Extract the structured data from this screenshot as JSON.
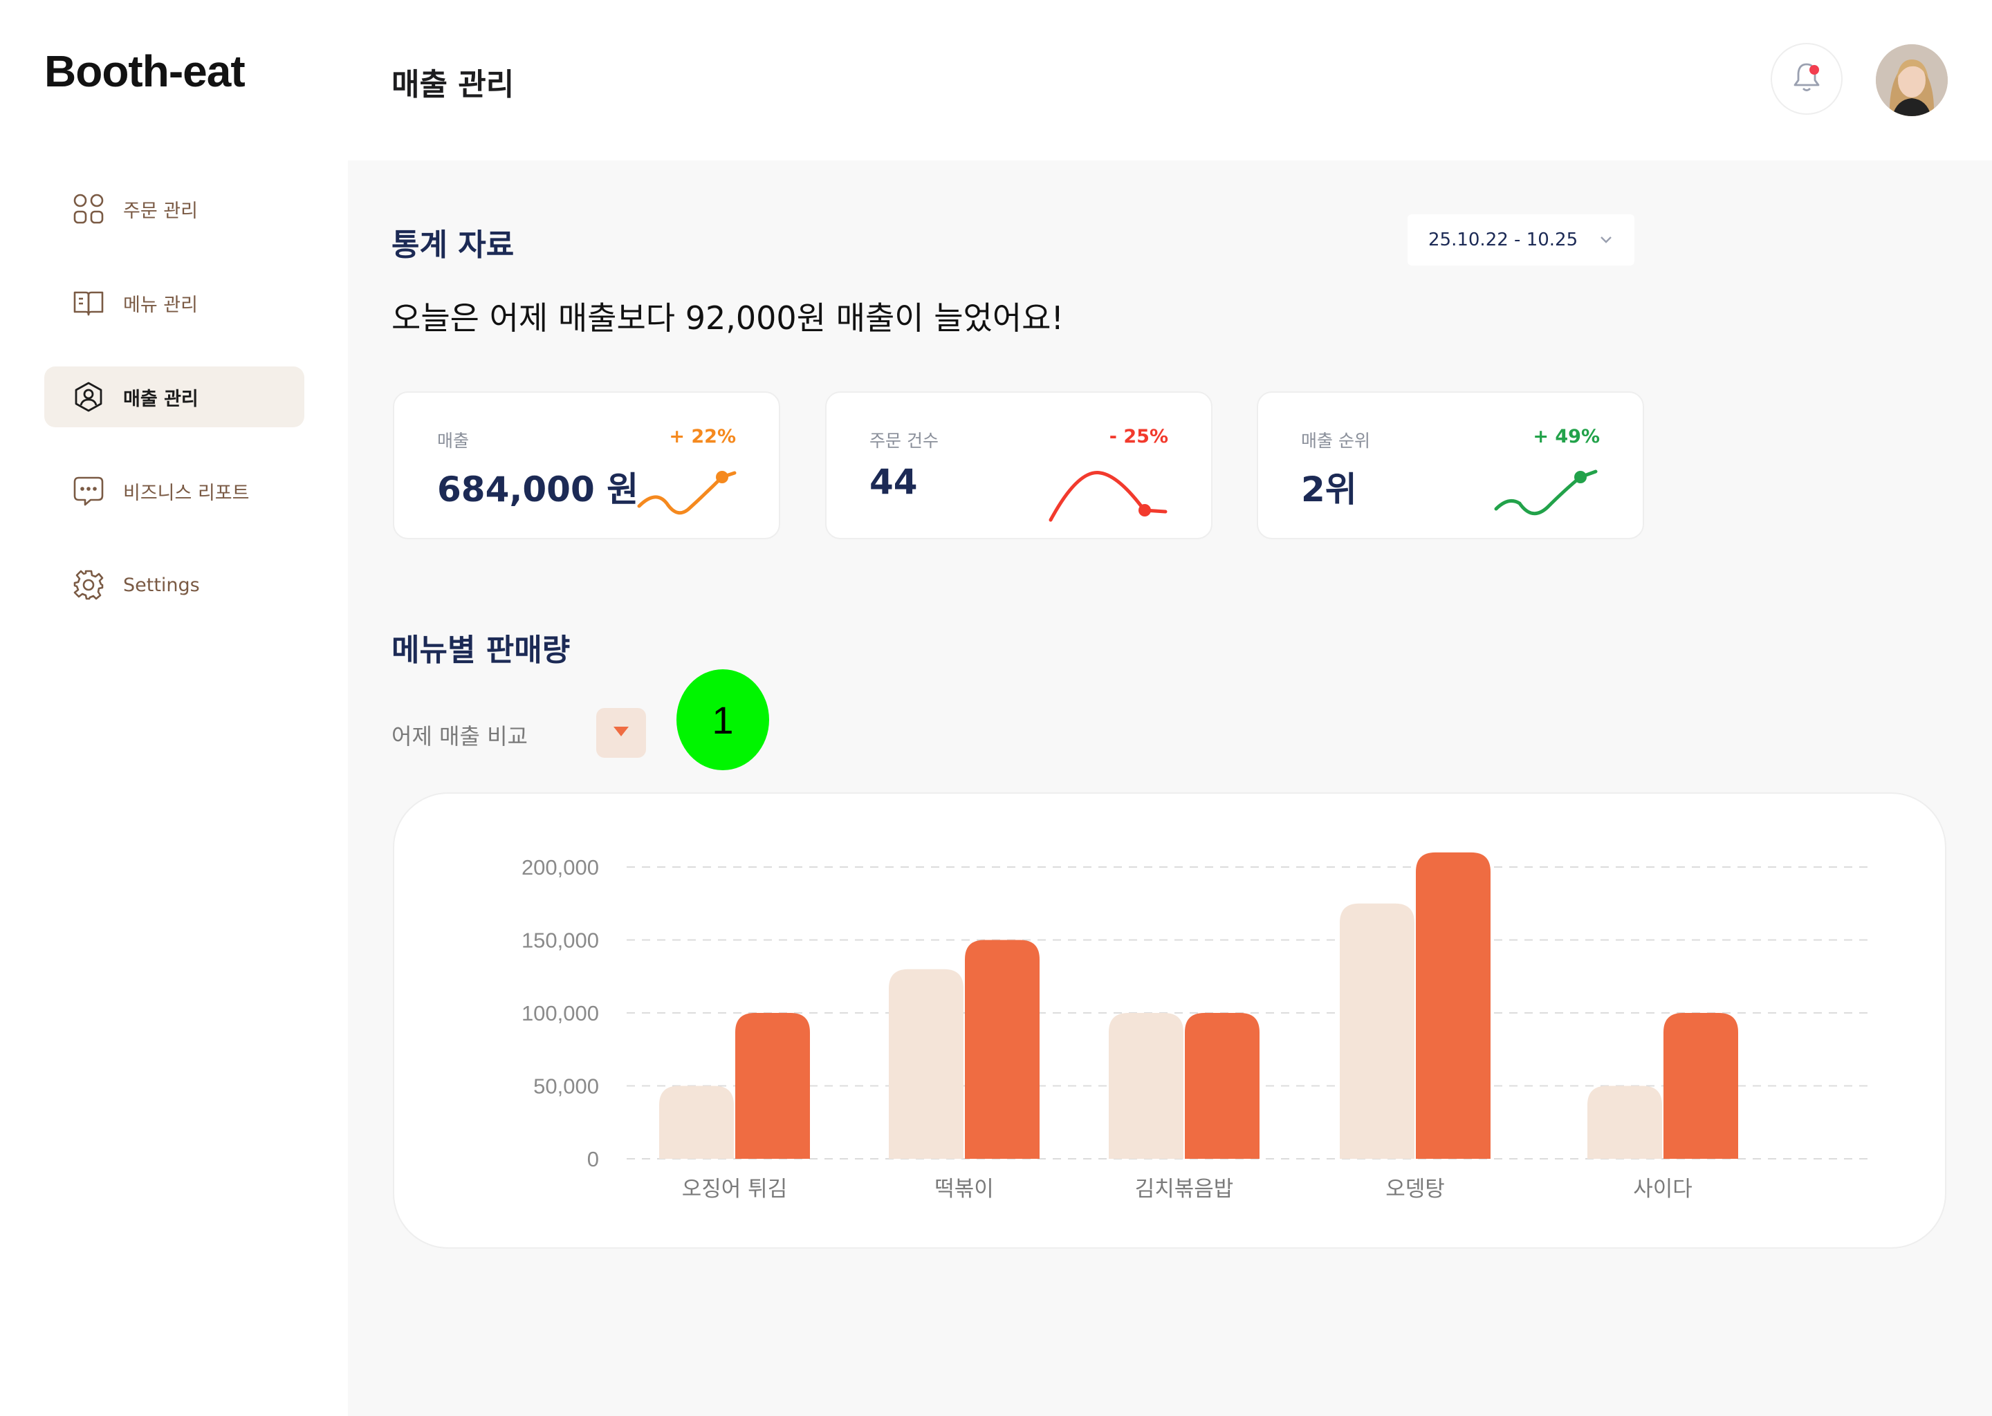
{
  "app": {
    "logo": "Booth-eat"
  },
  "header": {
    "title": "매출 관리"
  },
  "sidebar": {
    "items": [
      {
        "label": "주문 관리",
        "icon": "grid-icon",
        "active": false
      },
      {
        "label": "메뉴 관리",
        "icon": "book-icon",
        "active": false
      },
      {
        "label": "매출 관리",
        "icon": "user-shield-icon",
        "active": true
      },
      {
        "label": "비즈니스 리포트",
        "icon": "chat-icon",
        "active": false
      },
      {
        "label": "Settings",
        "icon": "gear-icon",
        "active": false
      }
    ]
  },
  "stats": {
    "title": "통계 자료",
    "date_range": "25.10.22 - 10.25",
    "headline": "오늘은 어제 매출보다 92,000원 매출이 늘었어요!",
    "cards": [
      {
        "label": "매출",
        "value": "684,000 원",
        "delta": "+ 22%",
        "color": "#f5891e"
      },
      {
        "label": "주문 건수",
        "value": "44",
        "delta": "- 25%",
        "color": "#f23a2d"
      },
      {
        "label": "매출 순위",
        "value": "2위",
        "delta": "+ 49%",
        "color": "#22a24a"
      }
    ]
  },
  "menu_sales": {
    "title": "메뉴별 판매량",
    "filter_label": "어제 매출 비교",
    "marker": "1"
  },
  "colors": {
    "accent": "#ef6c42",
    "light": "#f4e4d8",
    "navy": "#1c2a55"
  },
  "chart_data": {
    "type": "bar",
    "categories": [
      "오징어 튀김",
      "떡볶이",
      "김치볶음밥",
      "오뎅탕",
      "사이다"
    ],
    "series": [
      {
        "values": [
          50000,
          130000,
          100000,
          175000,
          50000
        ],
        "color": "#f4e4d8"
      },
      {
        "values": [
          100000,
          150000,
          100000,
          210000,
          100000
        ],
        "color": "#ef6c42"
      }
    ],
    "yticks": [
      "0",
      "50,000",
      "100,000",
      "150,000",
      "200,000"
    ],
    "ylim": [
      0,
      200000
    ],
    "grid": true
  }
}
